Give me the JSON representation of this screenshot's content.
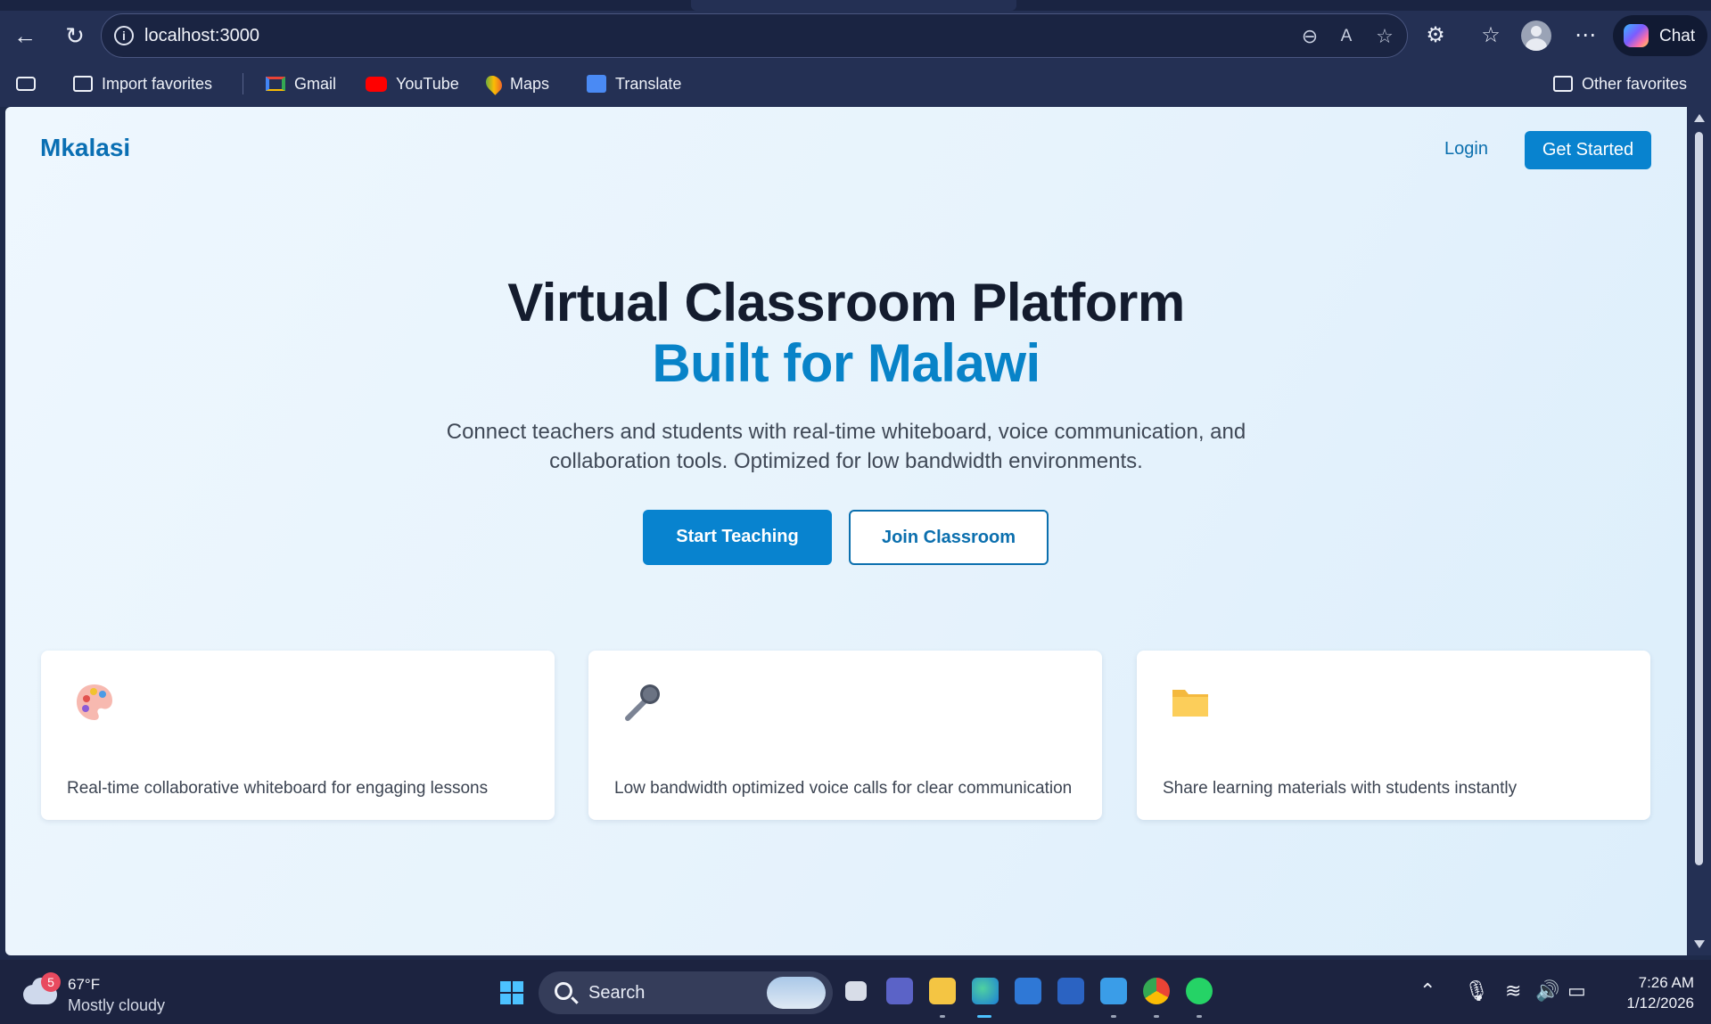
{
  "browser": {
    "url": "localhost:3000",
    "chat_label": "Chat",
    "bookmarks": [
      {
        "label": "Import favorites",
        "icon": "import-favorites-icon"
      },
      {
        "label": "Gmail",
        "icon": "gmail-icon"
      },
      {
        "label": "YouTube",
        "icon": "youtube-icon"
      },
      {
        "label": "Maps",
        "icon": "maps-icon"
      },
      {
        "label": "Translate",
        "icon": "translate-icon"
      }
    ],
    "other_favorites": "Other favorites"
  },
  "page": {
    "brand": "Mkalasi",
    "nav": {
      "login": "Login",
      "get_started": "Get Started"
    },
    "hero": {
      "title": "Virtual Classroom Platform",
      "subtitle": "Built for Malawi",
      "description": "Connect teachers and students with real-time whiteboard, voice communication, and collaboration tools. Optimized for low bandwidth environments."
    },
    "buttons": {
      "start_teaching": "Start Teaching",
      "join_classroom": "Join Classroom"
    },
    "features": [
      {
        "icon": "palette-icon",
        "text": "Real-time collaborative whiteboard for engaging lessons"
      },
      {
        "icon": "microphone-icon",
        "text": "Low bandwidth optimized voice calls for clear communication"
      },
      {
        "icon": "folder-icon",
        "text": "Share learning materials with students instantly"
      }
    ],
    "colors": {
      "primary": "#0883cf",
      "brand": "#0a6fb3",
      "heading": "#141c2e"
    }
  },
  "taskbar": {
    "weather": {
      "badge": "5",
      "temp": "67°F",
      "condition": "Mostly cloudy"
    },
    "search_label": "Search",
    "time": "7:26 AM",
    "date": "1/12/2026"
  }
}
